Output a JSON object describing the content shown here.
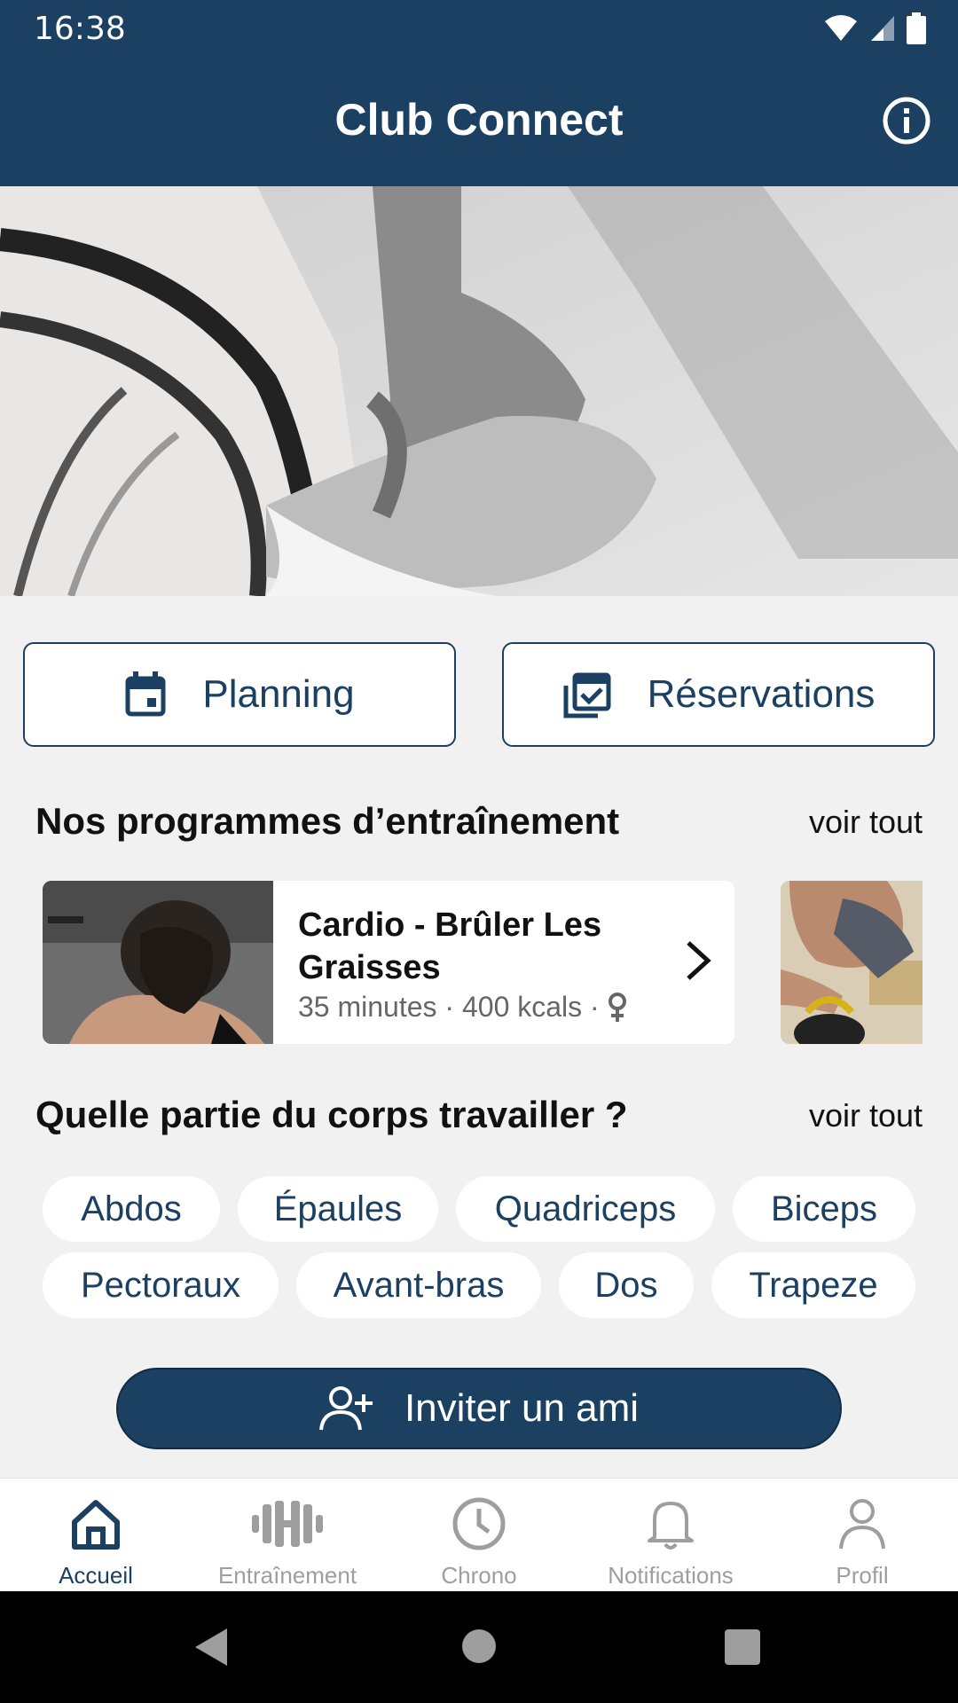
{
  "status_bar": {
    "time": "16:38"
  },
  "app_bar": {
    "title": "Club Connect"
  },
  "quick_actions": {
    "planning_label": "Planning",
    "reservations_label": "Réservations"
  },
  "programs": {
    "title": "Nos programmes d’entraînement",
    "see_all": "voir tout",
    "items": [
      {
        "name": "Cardio - Brûler Les Graisses",
        "meta": "35 minutes · 400 kcals ·"
      }
    ]
  },
  "body_parts": {
    "title": "Quelle partie du corps travailler ?",
    "see_all": "voir tout",
    "chips": [
      "Abdos",
      "Épaules",
      "Quadriceps",
      "Biceps",
      "Pectoraux",
      "Avant-bras",
      "Dos",
      "Trapeze"
    ]
  },
  "invite": {
    "label": "Inviter un ami"
  },
  "bottom_nav": {
    "items": [
      {
        "label": "Accueil",
        "icon": "home-icon",
        "active": true
      },
      {
        "label": "Entraînement",
        "icon": "dumbbell-icon",
        "active": false
      },
      {
        "label": "Chrono",
        "icon": "clock-icon",
        "active": false
      },
      {
        "label": "Notifications",
        "icon": "bell-icon",
        "active": false
      },
      {
        "label": "Profil",
        "icon": "person-icon",
        "active": false
      }
    ]
  },
  "colors": {
    "primary": "#1b4061",
    "background": "#f1f1f1",
    "inactive": "#9e9e9e"
  }
}
